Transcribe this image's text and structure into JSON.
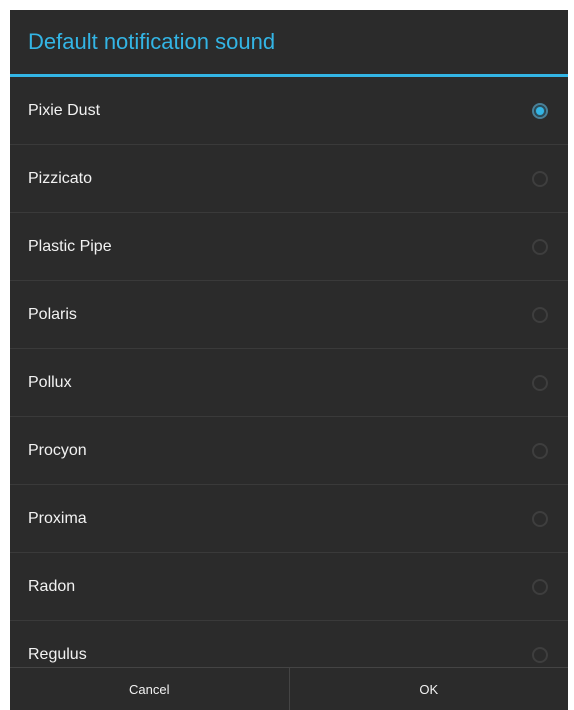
{
  "dialog": {
    "title": "Default notification sound",
    "items": [
      {
        "label": "Pixie Dust",
        "selected": true
      },
      {
        "label": "Pizzicato",
        "selected": false
      },
      {
        "label": "Plastic Pipe",
        "selected": false
      },
      {
        "label": "Polaris",
        "selected": false
      },
      {
        "label": "Pollux",
        "selected": false
      },
      {
        "label": "Procyon",
        "selected": false
      },
      {
        "label": "Proxima",
        "selected": false
      },
      {
        "label": "Radon",
        "selected": false
      },
      {
        "label": "Regulus",
        "selected": false
      }
    ],
    "buttons": {
      "cancel_label": "Cancel",
      "ok_label": "OK"
    }
  },
  "colors": {
    "accent": "#33b5e5",
    "background": "#2b2b2b",
    "text": "#f2f2f2"
  }
}
